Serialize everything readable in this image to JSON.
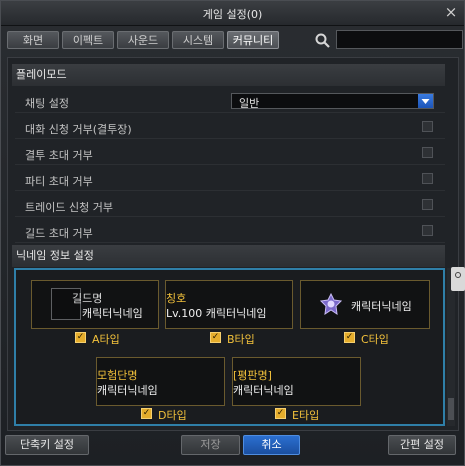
{
  "window": {
    "title": "게임 설정(0)",
    "close_glyph": "×"
  },
  "tabs": [
    {
      "label": "화면"
    },
    {
      "label": "이펙트"
    },
    {
      "label": "사운드"
    },
    {
      "label": "시스템"
    },
    {
      "label": "커뮤니티",
      "active": true
    }
  ],
  "search": {
    "value": "",
    "icon": "search-icon"
  },
  "play_mode": {
    "header": "플레이모드",
    "chat_setting": {
      "label": "채팅 설정",
      "selected": "일반"
    },
    "rows": [
      {
        "label": "대화 신청 거부(결투장)",
        "checked": false
      },
      {
        "label": "결투 초대 거부",
        "checked": false
      },
      {
        "label": "파티 초대 거부",
        "checked": false
      },
      {
        "label": "트레이드 신청 거부",
        "checked": false
      },
      {
        "label": "길드 초대 거부",
        "checked": false
      }
    ]
  },
  "nickname": {
    "header": "닉네임 정보 설정",
    "cards": [
      {
        "line1": "길드명",
        "line2": "캐릭터닉네임",
        "type_label": "A타입",
        "checked": true
      },
      {
        "line1": "칭호",
        "line2": "Lv.100 캐릭터닉네임",
        "type_label": "B타입",
        "checked": true
      },
      {
        "line1": "",
        "line2": "캐릭터닉네임",
        "type_label": "C타입",
        "checked": true
      },
      {
        "line1": "모험단명",
        "line2": "캐릭터닉네임",
        "type_label": "D타입",
        "checked": true
      },
      {
        "line1": "[평판명]",
        "line2": "캐릭터닉네임",
        "type_label": "E타입",
        "checked": true
      }
    ]
  },
  "footer": {
    "shortcut_label": "단축키 설정",
    "save_label": "저장",
    "cancel_label": "취소",
    "simple_label": "간편 설정"
  },
  "colors": {
    "accent_blue": "#2f7fa8",
    "gold": "#f2c13b",
    "primary_button": "#1b4fa0"
  }
}
